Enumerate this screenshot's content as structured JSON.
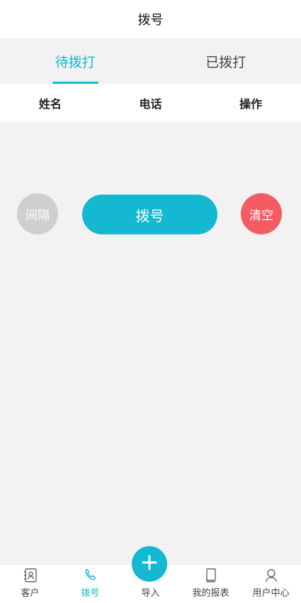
{
  "header": {
    "title": "拨号"
  },
  "tabs": [
    {
      "label": "待拨打",
      "active": true
    },
    {
      "label": "已拨打",
      "active": false
    }
  ],
  "columns": [
    "姓名",
    "电话",
    "操作"
  ],
  "actions": {
    "interval_label": "间隔",
    "dial_label": "拨号",
    "clear_label": "清空"
  },
  "tabbar": {
    "items": [
      {
        "label": "客户",
        "icon": "contacts-icon",
        "active": false
      },
      {
        "label": "拨号",
        "icon": "phone-icon",
        "active": true
      },
      {
        "label": "导入",
        "icon": "plus-icon",
        "active": false
      },
      {
        "label": "我的报表",
        "icon": "book-icon",
        "active": false
      },
      {
        "label": "用户中心",
        "icon": "user-icon",
        "active": false
      }
    ]
  },
  "colors": {
    "accent": "#14b8d0",
    "clear": "#f25c62",
    "interval": "#cfcfcf"
  }
}
